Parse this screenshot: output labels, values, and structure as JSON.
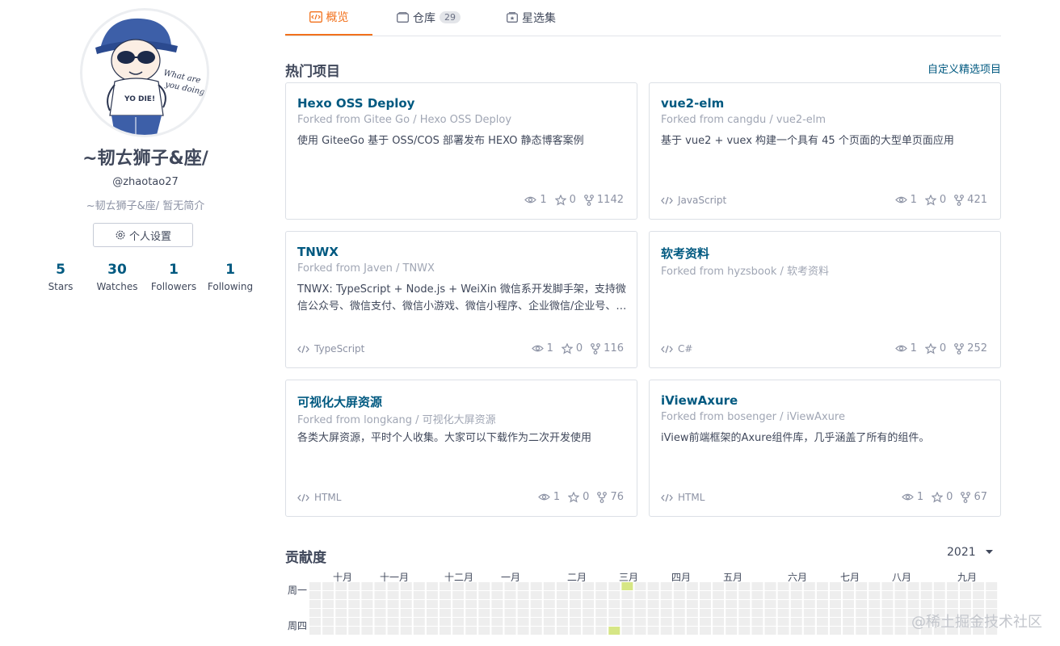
{
  "profile": {
    "avatar_text": "What are you doing?",
    "name": "~韧ㄊ狮子&座/",
    "username": "@zhaotao27",
    "bio": "~韧ㄊ狮子&座/ 暂无简介",
    "settings_label": "个人设置",
    "stats": [
      {
        "value": "5",
        "label": "Stars"
      },
      {
        "value": "30",
        "label": "Watches"
      },
      {
        "value": "1",
        "label": "Followers"
      },
      {
        "value": "1",
        "label": "Following"
      }
    ]
  },
  "tabs": [
    {
      "label": "概览",
      "active": true
    },
    {
      "label": "仓库",
      "badge": "29"
    },
    {
      "label": "星选集"
    }
  ],
  "popular": {
    "title": "热门项目",
    "custom_link": "自定义精选项目",
    "cards": [
      {
        "title": "Hexo OSS Deploy",
        "fork": "Forked from Gitee Go  / Hexo OSS Deploy",
        "desc": "使用 GiteeGo 基于 OSS/COS 部署发布 HEXO 静态博客案例",
        "lang": "",
        "watch": "1",
        "star": "0",
        "fork_count": "1142"
      },
      {
        "title": "vue2-elm",
        "fork": "Forked from cangdu  / vue2-elm",
        "desc": "基于 vue2 + vuex 构建一个具有 45 个页面的大型单页面应用",
        "lang": "JavaScript",
        "watch": "1",
        "star": "0",
        "fork_count": "421"
      },
      {
        "title": "TNWX",
        "fork": "Forked from Javen  / TNWX",
        "desc": "TNWX: TypeScript + Node.js + WeiXin 微信系开发脚手架，支持微信公众号、微信支付、微信小游戏、微信小程序、企业微信/企业号、企业微信开放平台",
        "lang": "TypeScript",
        "watch": "1",
        "star": "0",
        "fork_count": "116"
      },
      {
        "title": "软考资料",
        "fork": "Forked from hyzsbook  / 软考资料",
        "desc": "",
        "lang": "C#",
        "watch": "1",
        "star": "0",
        "fork_count": "252"
      },
      {
        "title": "可视化大屏资源",
        "fork": "Forked from longkang  / 可视化大屏资源",
        "desc": "各类大屏资源，平时个人收集。大家可以下载作为二次开发使用",
        "lang": "HTML",
        "watch": "1",
        "star": "0",
        "fork_count": "76"
      },
      {
        "title": "iViewAxure",
        "fork": "Forked from bosenger  / iViewAxure",
        "desc": "iView前端框架的Axure组件库，几乎涵盖了所有的组件。",
        "lang": "HTML",
        "watch": "1",
        "star": "0",
        "fork_count": "67"
      }
    ]
  },
  "contrib": {
    "title": "贡献度",
    "year": "2021",
    "months": [
      "十月",
      "十一月",
      "十二月",
      "一月",
      "二月",
      "三月",
      "四月",
      "五月",
      "六月",
      "七月",
      "八月",
      "九月"
    ],
    "weekdays": [
      "周一",
      "周四"
    ],
    "empty_color": "#eeeeee",
    "active_color": "#d6e685",
    "active_weeks_row1": [
      24,
      53
    ],
    "active_weeks_row4": [
      23
    ]
  },
  "watermark": "@稀土掘金技术社区"
}
